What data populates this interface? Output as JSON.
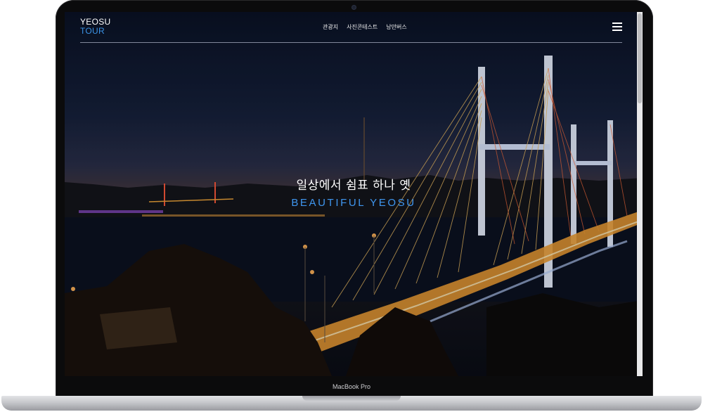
{
  "device": {
    "label": "MacBook Pro"
  },
  "site": {
    "logo_line1": "YEOSU",
    "logo_line2": "TOUR",
    "nav": [
      "관광지",
      "사진콘테스트",
      "낭만버스"
    ],
    "menu_icon": "hamburger-menu-icon"
  },
  "hero": {
    "title": "일상에서 쉼표 하나 옛",
    "subtitle": "BEAUTIFUL YEOSU"
  },
  "colors": {
    "accent_blue": "#3b93e6",
    "bezel": "#0b0b0c",
    "bridge_light": "#f2a63a"
  }
}
